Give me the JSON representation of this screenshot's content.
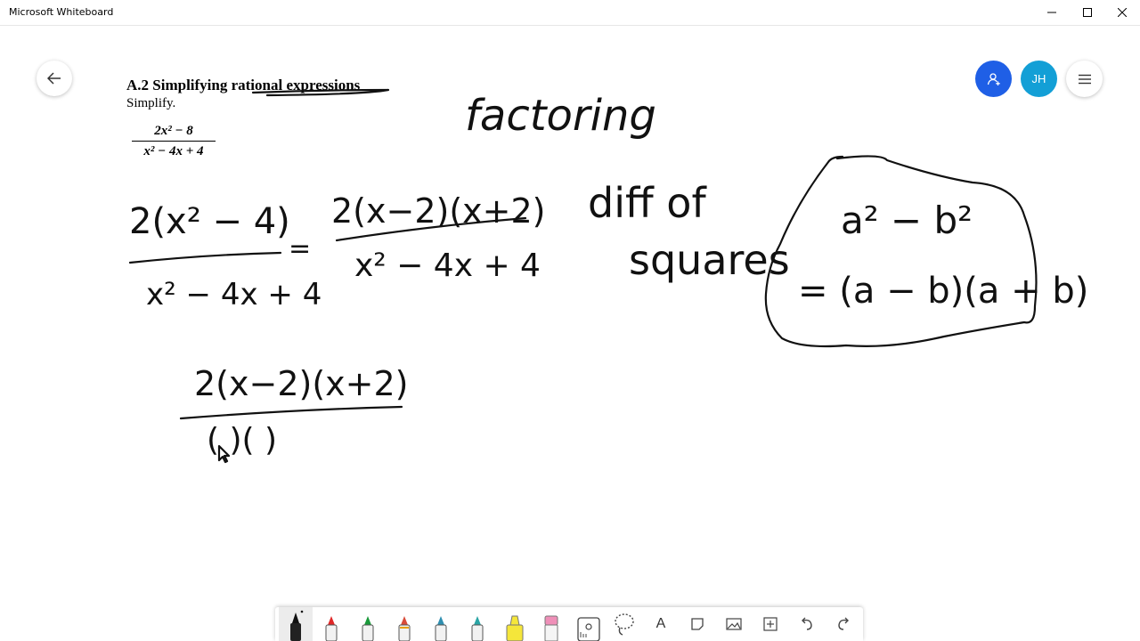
{
  "window": {
    "title": "Microsoft Whiteboard"
  },
  "header": {
    "avatar_initials": "JH",
    "share_color": "#1f5fe6",
    "avatar_color": "#139fd6"
  },
  "document": {
    "heading": "A.2 Simplifying rational expressions",
    "instruction": "Simplify.",
    "numerator": "2x² − 8",
    "denominator": "x² − 4x + 4"
  },
  "ink": {
    "top_label": "factoring",
    "side_label_line1": "diff of",
    "side_label_line2": "squares",
    "step1_numerator": "2(x² − 4)",
    "step1_denominator": "x² − 4x + 4",
    "step2_numerator": "2(x−2)(x+2)",
    "step2_denominator": "x² − 4x + 4",
    "step3_numerator": "2(x−2)(x+2)",
    "step3_denominator": "(   )(   )",
    "box_line1": "a² − b²",
    "box_line2": "= (a − b)(a + b)"
  },
  "toolbar": {
    "tools": [
      {
        "name": "black-pen",
        "color": "#111111"
      },
      {
        "name": "red-pen",
        "color": "#e02828"
      },
      {
        "name": "green-pen",
        "color": "#1a9a3a"
      },
      {
        "name": "rainbow-pen",
        "color": "#d84c3a"
      },
      {
        "name": "galaxy-pen",
        "color": "#2f8fb0"
      },
      {
        "name": "teal-pen",
        "color": "#2aa5a5"
      },
      {
        "name": "highlighter",
        "color": "#f5e63a"
      },
      {
        "name": "eraser",
        "color": "#ef8fb8"
      }
    ],
    "text_tool_label": "A"
  }
}
